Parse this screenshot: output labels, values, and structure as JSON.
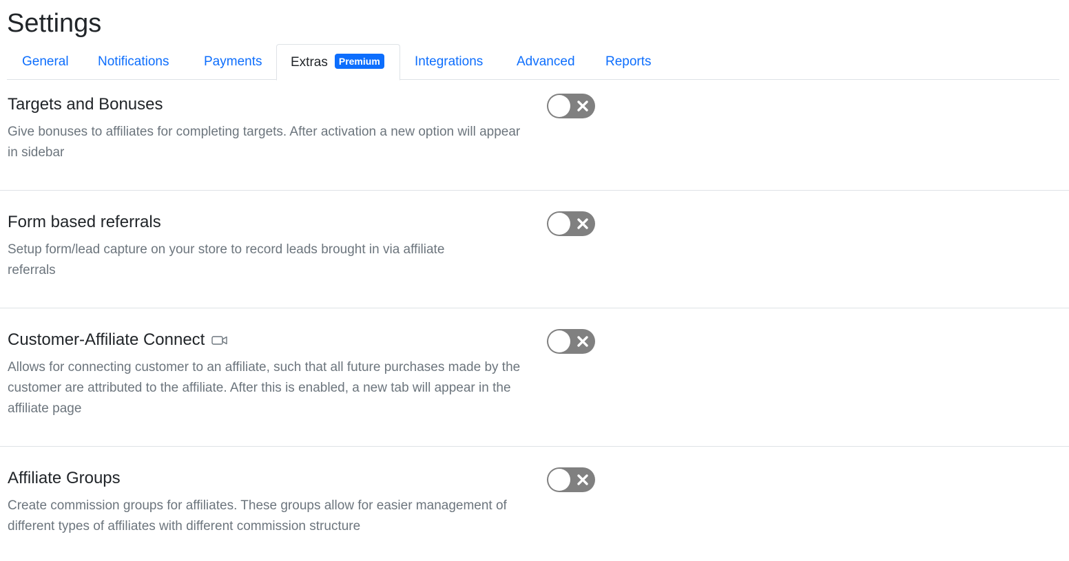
{
  "page": {
    "title": "Settings"
  },
  "tabs": [
    {
      "label": "General",
      "active": false
    },
    {
      "label": "Notifications",
      "active": false
    },
    {
      "label": "Payments",
      "active": false
    },
    {
      "label": "Extras",
      "active": true,
      "badge": "Premium"
    },
    {
      "label": "Integrations",
      "active": false
    },
    {
      "label": "Advanced",
      "active": false
    },
    {
      "label": "Reports",
      "active": false
    }
  ],
  "settings": [
    {
      "title": "Targets and Bonuses",
      "description": "Give bonuses to affiliates for completing targets. After activation a new option will appear in sidebar",
      "enabled": false
    },
    {
      "title": "Form based referrals",
      "description": "Setup form/lead capture on your store to record leads brought in via affiliate referrals",
      "enabled": false
    },
    {
      "title": "Customer-Affiliate Connect",
      "icon": "video-camera-icon",
      "description": "Allows for connecting customer to an affiliate, such that all future purchases made by the customer are attributed to the affiliate. After this is enabled, a new tab will appear in the affiliate page",
      "enabled": false
    },
    {
      "title": "Affiliate Groups",
      "description": "Create commission groups for affiliates. These groups allow for easier management of different types of affiliates with different commission structure",
      "enabled": false
    }
  ],
  "colors": {
    "link": "#0d6efd",
    "badge": "#0d6efd",
    "toggle_off": "#808080",
    "muted_text": "#6c757d"
  }
}
